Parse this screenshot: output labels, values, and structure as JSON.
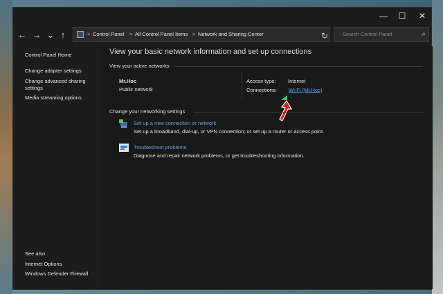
{
  "window": {
    "controls": {
      "minimize": "—",
      "maximize": "☐",
      "close": "✕"
    }
  },
  "address_bar": {
    "nav": {
      "back": "←",
      "forward": "→",
      "recent": "⌄",
      "up": "↑"
    },
    "breadcrumbs": [
      "Control Panel",
      "All Control Panel Items",
      "Network and Sharing Center"
    ],
    "separator": ">",
    "refresh": "↻",
    "search_placeholder": "Search Control Panel",
    "search_icon": "⌕"
  },
  "sidebar": {
    "top_links": [
      "Control Panel Home",
      "Change adapter settings",
      "Change advanced sharing",
      "settings",
      "Media streaming options"
    ],
    "see_also_heading": "See also",
    "see_also_links": [
      "Internet Options",
      "Windows Defender Firewall"
    ]
  },
  "main": {
    "title": "View your basic network information and set up connections",
    "active_networks_heading": "View your active networks",
    "network": {
      "name": "Mr.Hoc",
      "type": "Public network",
      "access_type_label": "Access type:",
      "access_type_value": "Internet",
      "connections_label": "Connections:",
      "connection_link": "Wi-Fi (Mr.Hoc)"
    },
    "settings_heading": "Change your networking settings",
    "tasks": [
      {
        "icon": "network-setup-icon",
        "title": "Set up a new connection or network",
        "description": "Set up a broadband, dial-up, or VPN connection; or set up a router or access point."
      },
      {
        "icon": "troubleshoot-icon",
        "title": "Troubleshoot problems",
        "description": "Diagnose and repair network problems, or get troubleshooting information."
      }
    ]
  },
  "colors": {
    "window_bg": "#1c1c1c",
    "link": "#5fa8f0",
    "text": "#e6e6e6",
    "annotation_arrow": "#e0201c"
  }
}
